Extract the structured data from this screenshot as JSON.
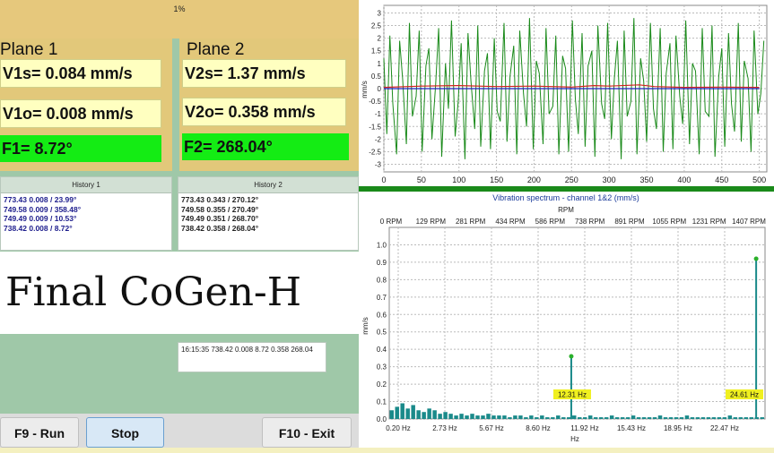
{
  "progress": {
    "label": "1%",
    "value": 1
  },
  "plane1": {
    "title": "Plane 1",
    "vs": "V1s= 0.084 mm/s",
    "vo": "V1o= 0.008 mm/s",
    "phase": "F1= 8.72°"
  },
  "plane2": {
    "title": "Plane 2",
    "vs": "V2s= 1.37 mm/s",
    "vo": "V2o= 0.358 mm/s",
    "phase": "F2= 268.04°"
  },
  "history1": {
    "title": "History 1",
    "lines": [
      "773.43 0.008 / 23.99°",
      "749.58 0.009 / 358.48°",
      "749.49 0.009 / 10.53°",
      "738.42 0.008 / 8.72°"
    ]
  },
  "history2": {
    "title": "History 2",
    "lines": [
      "773.43 0.343 / 270.12°",
      "749.58 0.355 / 270.49°",
      "749.49 0.351 / 268.70°",
      "738.42 0.358 / 268.04°"
    ]
  },
  "big_title": "Final CoGen-H",
  "log": "16:15:35 738.42 0.008 8.72 0.358 268.04",
  "buttons": {
    "run": "F9 - Run",
    "stop": "Stop",
    "exit": "F10 - Exit"
  },
  "colors": {
    "panel_bg": "#9fc8a8",
    "plane_bg": "#e2c87a",
    "value_bg": "#ffffc0",
    "phase_bg": "#14ec14",
    "waveform_green": "#1a8a1a",
    "waveform_red": "#d02020",
    "waveform_blue": "#2020c0",
    "spectrum_bar": "#1a8a8a",
    "peak_label_bg": "#f0f020"
  },
  "chart_data": [
    {
      "type": "line",
      "title": "",
      "xlabel": "",
      "ylabel": "mm/s",
      "xlim": [
        0,
        510
      ],
      "ylim": [
        -3.3,
        3.3
      ],
      "x_ticks": [
        0,
        50,
        100,
        150,
        200,
        250,
        300,
        350,
        400,
        450,
        500
      ],
      "y_ticks": [
        3,
        2.5,
        2,
        1.5,
        1,
        0.5,
        0,
        -0.5,
        -1,
        -1.5,
        -2,
        -2.5,
        -3
      ],
      "grid": true,
      "series": [
        {
          "values_note": "",
          "x": [
            0,
            4,
            8,
            12,
            17,
            21,
            25,
            30,
            34,
            38,
            43,
            47,
            51,
            56,
            60,
            64,
            69,
            73,
            77,
            82,
            86,
            90,
            95,
            99,
            103,
            108,
            112,
            116,
            121,
            125,
            129,
            134,
            138,
            142,
            147,
            151,
            155,
            160,
            164,
            168,
            173,
            177,
            181,
            186,
            190,
            194,
            199,
            203,
            207,
            212,
            216,
            220,
            225,
            229,
            233,
            238,
            242,
            246,
            251,
            255,
            259,
            264,
            268,
            272,
            277,
            281,
            285,
            290,
            294,
            298,
            303,
            307,
            311,
            316,
            320,
            324,
            329,
            333,
            337,
            342,
            346,
            350,
            355,
            359,
            363,
            368,
            372,
            376,
            381,
            385,
            389,
            394,
            398,
            402,
            407,
            411,
            415,
            420,
            424,
            428,
            433,
            437,
            441,
            446,
            450,
            454,
            459,
            463,
            467,
            472,
            476,
            480,
            485,
            489,
            493,
            498,
            502,
            506
          ],
          "y": [
            1.2,
            -1.8,
            2.1,
            -0.6,
            -2.6,
            1.9,
            0.4,
            -2.2,
            2.6,
            -1.1,
            -0.3,
            2.3,
            -2.5,
            0.9,
            1.6,
            -2.0,
            0.2,
            2.4,
            -2.7,
            1.0,
            -0.8,
            2.7,
            -1.9,
            -0.5,
            1.8,
            -2.8,
            2.2,
            0.3,
            -1.6,
            2.5,
            -2.3,
            0.7,
            1.4,
            -2.4,
            2.0,
            -0.9,
            -1.3,
            2.6,
            -2.1,
            0.5,
            1.7,
            -2.6,
            2.3,
            -0.2,
            -1.5,
            2.8,
            -2.4,
            1.1,
            0.6,
            -2.2,
            2.4,
            -1.0,
            -0.7,
            2.1,
            -2.6,
            1.3,
            0.8,
            -2.5,
            2.7,
            -0.4,
            -1.8,
            2.2,
            -2.3,
            0.9,
            1.5,
            -2.7,
            2.5,
            -0.6,
            -1.2,
            2.6,
            -2.0,
            0.4,
            1.9,
            -2.8,
            2.3,
            -1.1,
            -0.5,
            2.8,
            -2.6,
            1.2,
            0.3,
            -2.1,
            2.6,
            -0.8,
            -1.6,
            2.4,
            -2.5,
            0.6,
            1.8,
            -2.4,
            2.1,
            -0.3,
            -1.4,
            2.7,
            -2.2,
            1.0,
            0.7,
            -2.6,
            2.4,
            -0.9,
            -1.1,
            2.5,
            -2.7,
            0.5,
            1.6,
            -2.3,
            2.2,
            -0.6,
            -1.7,
            2.6,
            -2.1,
            1.1,
            0.4,
            -2.5,
            2.3,
            -1.0,
            -0.2,
            1.9
          ]
        },
        {
          "x": [
            0,
            50,
            100,
            150,
            200,
            250,
            280,
            300,
            340,
            360,
            400,
            450,
            500
          ],
          "y": [
            0.05,
            0.1,
            0.12,
            0.08,
            0.1,
            0.06,
            0.12,
            0.1,
            0.15,
            0.08,
            0.05,
            0.06,
            0.05
          ]
        },
        {
          "x": [
            0,
            100,
            200,
            300,
            400,
            500
          ],
          "y": [
            0,
            0,
            0,
            0,
            0,
            0
          ]
        }
      ]
    },
    {
      "type": "bar",
      "title": "Vibration spectrum - channel 1&2 (mm/s)",
      "xlabel": "Hz",
      "ylabel": "mm/s",
      "top_axis_label": "RPM",
      "top_ticks": [
        "0 RPM",
        "129 RPM",
        "281 RPM",
        "434 RPM",
        "586 RPM",
        "738 RPM",
        "891 RPM",
        "1055 RPM",
        "1231 RPM",
        "1407 RPM"
      ],
      "x_ticks": [
        "0.20 Hz",
        "2.73 Hz",
        "5.67 Hz",
        "8.60 Hz",
        "11.92 Hz",
        "15.43 Hz",
        "18.95 Hz",
        "22.47 Hz"
      ],
      "xlim": [
        0.2,
        25.2
      ],
      "ylim": [
        0,
        1.1
      ],
      "y_ticks": [
        0,
        0.1,
        0.2,
        0.3,
        0.4,
        0.5,
        0.6,
        0.7,
        0.8,
        0.9,
        1.0
      ],
      "grid": true,
      "peaks": [
        {
          "x": 12.31,
          "value": 0.36,
          "label": "12.31 Hz"
        },
        {
          "x": 24.61,
          "value": 0.92,
          "label": "24.61 Hz"
        }
      ],
      "bars": [
        0.05,
        0.07,
        0.09,
        0.06,
        0.08,
        0.05,
        0.04,
        0.06,
        0.05,
        0.03,
        0.04,
        0.03,
        0.02,
        0.03,
        0.02,
        0.03,
        0.02,
        0.02,
        0.03,
        0.02,
        0.02,
        0.02,
        0.01,
        0.02,
        0.02,
        0.01,
        0.02,
        0.01,
        0.02,
        0.01,
        0.01,
        0.02,
        0.01,
        0.01,
        0.02,
        0.01,
        0.01,
        0.02,
        0.01,
        0.01,
        0.01,
        0.02,
        0.01,
        0.01,
        0.01,
        0.02,
        0.01,
        0.01,
        0.01,
        0.01,
        0.02,
        0.01,
        0.01,
        0.01,
        0.01,
        0.02,
        0.01,
        0.01,
        0.01,
        0.01,
        0.01,
        0.01,
        0.01,
        0.02,
        0.01,
        0.01,
        0.01,
        0.01,
        0.01,
        0.01
      ]
    }
  ]
}
